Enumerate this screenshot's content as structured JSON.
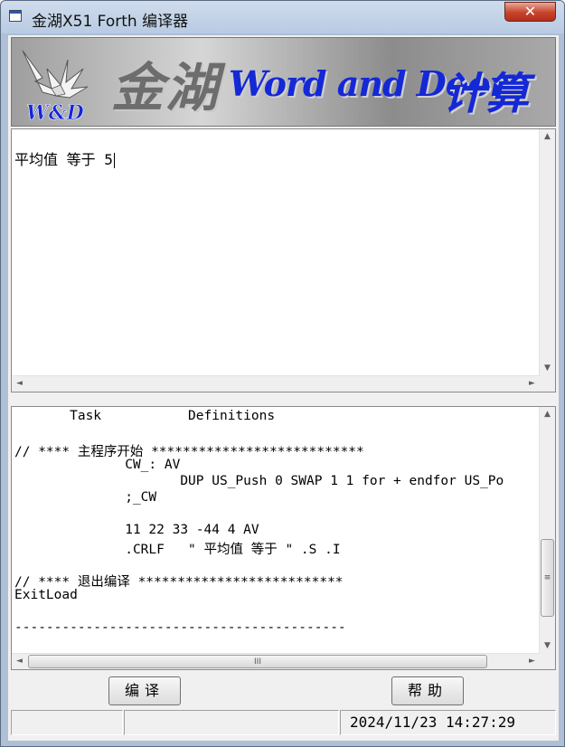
{
  "window": {
    "title": "金湖X51 Forth 编译器",
    "close_glyph": "✕"
  },
  "banner": {
    "logo_text": "W&D",
    "chinese_name": "金湖",
    "english_name": "Word and Door",
    "chinese_suffix": "计算机"
  },
  "input_pane": {
    "text": "平均值 等于 5"
  },
  "code_pane": {
    "lines": [
      "       Task           Definitions",
      "",
      "// **** 主程序开始 ***************************",
      "              CW_: AV",
      "                     DUP US_Push 0 SWAP 1 1 for + endfor US_Po",
      "              ;_CW",
      "",
      "              11 22 33 -44 4 AV",
      "              .CRLF   \" 平均值 等于 \" .S .I",
      "",
      "// **** 退出编译 **************************",
      "ExitLoad",
      "",
      "------------------------------------------"
    ]
  },
  "buttons": {
    "compile": "编译",
    "help": "帮助"
  },
  "statusbar": {
    "cell1": "",
    "cell2": "",
    "datetime": "2024/11/23 14:27:29"
  },
  "icons": {
    "up": "▲",
    "down": "▼",
    "left": "◄",
    "right": "►",
    "grip_v": "≡",
    "grip_h": "III"
  }
}
